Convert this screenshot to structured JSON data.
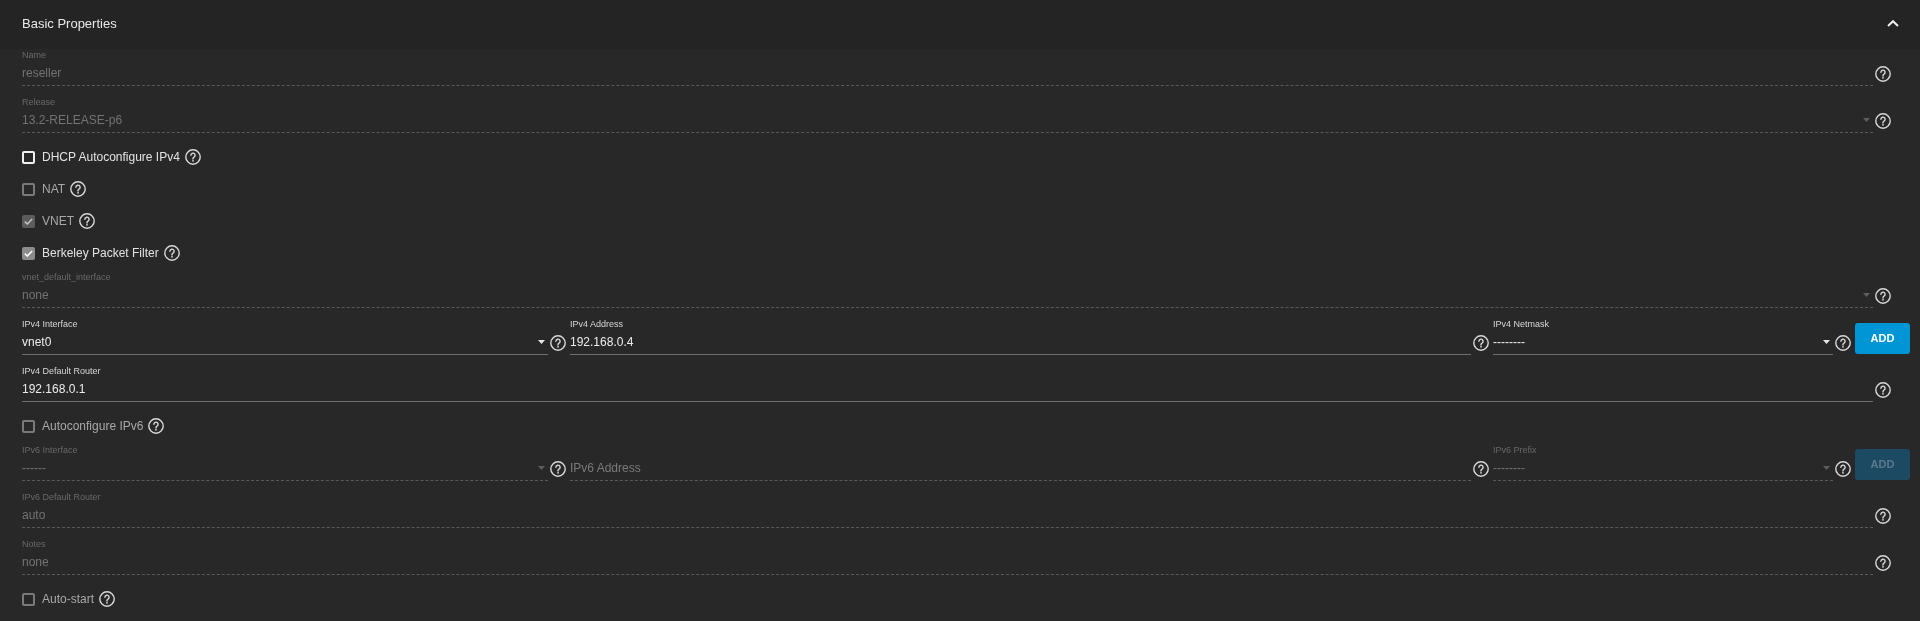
{
  "panel": {
    "title": "Basic Properties",
    "expanded": true
  },
  "form": [
    {
      "kind": "text_field",
      "label": "Name",
      "value": "reseller",
      "disabled": true
    },
    {
      "kind": "dropdown",
      "label": "Release",
      "value": "13.2-RELEASE-p6",
      "disabled": true
    },
    {
      "kind": "checkbox",
      "label": "DHCP Autoconfigure IPv4",
      "checked": false,
      "disabled": false
    },
    {
      "kind": "checkbox",
      "label": "NAT",
      "checked": false,
      "disabled": true
    },
    {
      "kind": "checkbox",
      "label": "VNET",
      "checked": true,
      "disabled": true
    },
    {
      "kind": "checkbox",
      "label": "Berkeley Packet Filter",
      "checked": true,
      "disabled": false
    },
    {
      "kind": "dropdown",
      "label": "vnet_default_interface",
      "value": "none",
      "disabled": true
    },
    {
      "kind": "field_row",
      "fields": [
        {
          "kind": "dropdown",
          "label": "IPv4 Interface",
          "value": "vnet0",
          "disabled": false
        },
        {
          "kind": "text_field",
          "label": "IPv4 Address",
          "value": "192.168.0.4",
          "disabled": false
        },
        {
          "kind": "dropdown",
          "label": "IPv4 Netmask",
          "value": "--------",
          "disabled": false
        }
      ],
      "button": {
        "label": "ADD",
        "disabled": false
      }
    },
    {
      "kind": "text_field",
      "label": "IPv4 Default Router",
      "value": "192.168.0.1",
      "disabled": false
    },
    {
      "kind": "checkbox",
      "label": "Autoconfigure IPv6",
      "checked": false,
      "disabled": true
    },
    {
      "kind": "field_row",
      "fields": [
        {
          "kind": "dropdown",
          "label": "IPv6 Interface",
          "value": "------",
          "disabled": true
        },
        {
          "kind": "text_field",
          "placeholder": "IPv6 Address",
          "disabled": true
        },
        {
          "kind": "dropdown",
          "label": "IPv6 Prefix",
          "value": "--------",
          "disabled": true
        }
      ],
      "button": {
        "label": "ADD",
        "disabled": true
      }
    },
    {
      "kind": "text_field",
      "label": "IPv6 Default Router",
      "value": "auto",
      "disabled": true
    },
    {
      "kind": "text_field",
      "label": "Notes",
      "value": "none",
      "disabled": true
    },
    {
      "kind": "checkbox",
      "label": "Auto-start",
      "checked": false,
      "disabled": true
    }
  ]
}
